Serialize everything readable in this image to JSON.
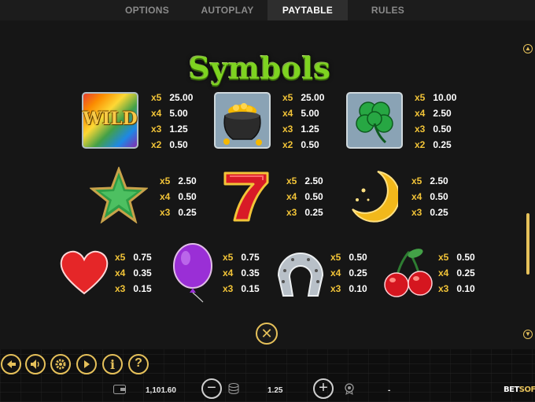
{
  "tabs": [
    {
      "label": "OPTIONS",
      "active": false
    },
    {
      "label": "AUTOPLAY",
      "active": false
    },
    {
      "label": "PAYTABLE",
      "active": true
    },
    {
      "label": "RULES",
      "active": false
    }
  ],
  "paytable": {
    "title": "Symbols",
    "wild_label": "WILD",
    "symbols": [
      {
        "name": "wild",
        "icon": "wild-rainbow-icon",
        "pays": [
          {
            "mult": "x5",
            "value": "25.00"
          },
          {
            "mult": "x4",
            "value": "5.00"
          },
          {
            "mult": "x3",
            "value": "1.25"
          },
          {
            "mult": "x2",
            "value": "0.50"
          }
        ]
      },
      {
        "name": "pot-of-gold",
        "icon": "pot-of-gold-icon",
        "pays": [
          {
            "mult": "x5",
            "value": "25.00"
          },
          {
            "mult": "x4",
            "value": "5.00"
          },
          {
            "mult": "x3",
            "value": "1.25"
          },
          {
            "mult": "x2",
            "value": "0.50"
          }
        ]
      },
      {
        "name": "clover",
        "icon": "four-leaf-clover-icon",
        "pays": [
          {
            "mult": "x5",
            "value": "10.00"
          },
          {
            "mult": "x4",
            "value": "2.50"
          },
          {
            "mult": "x3",
            "value": "0.50"
          },
          {
            "mult": "x2",
            "value": "0.25"
          }
        ]
      },
      {
        "name": "star",
        "icon": "green-star-icon",
        "pays": [
          {
            "mult": "x5",
            "value": "2.50"
          },
          {
            "mult": "x4",
            "value": "0.50"
          },
          {
            "mult": "x3",
            "value": "0.25"
          }
        ]
      },
      {
        "name": "seven",
        "icon": "lucky-seven-icon",
        "pays": [
          {
            "mult": "x5",
            "value": "2.50"
          },
          {
            "mult": "x4",
            "value": "0.50"
          },
          {
            "mult": "x3",
            "value": "0.25"
          }
        ]
      },
      {
        "name": "moon",
        "icon": "crescent-moon-icon",
        "pays": [
          {
            "mult": "x5",
            "value": "2.50"
          },
          {
            "mult": "x4",
            "value": "0.50"
          },
          {
            "mult": "x3",
            "value": "0.25"
          }
        ]
      },
      {
        "name": "heart",
        "icon": "red-heart-icon",
        "pays": [
          {
            "mult": "x5",
            "value": "0.75"
          },
          {
            "mult": "x4",
            "value": "0.35"
          },
          {
            "mult": "x3",
            "value": "0.15"
          }
        ]
      },
      {
        "name": "balloon",
        "icon": "purple-balloon-icon",
        "pays": [
          {
            "mult": "x5",
            "value": "0.75"
          },
          {
            "mult": "x4",
            "value": "0.35"
          },
          {
            "mult": "x3",
            "value": "0.15"
          }
        ]
      },
      {
        "name": "horseshoe",
        "icon": "horseshoe-icon",
        "pays": [
          {
            "mult": "x5",
            "value": "0.50"
          },
          {
            "mult": "x4",
            "value": "0.25"
          },
          {
            "mult": "x3",
            "value": "0.10"
          }
        ]
      },
      {
        "name": "cherries",
        "icon": "cherries-icon",
        "pays": [
          {
            "mult": "x5",
            "value": "0.50"
          },
          {
            "mult": "x4",
            "value": "0.25"
          },
          {
            "mult": "x3",
            "value": "0.10"
          }
        ]
      }
    ]
  },
  "controls": {
    "icons": [
      "back-arrow-icon",
      "sound-icon",
      "settings-gear-icon",
      "autoplay-icon",
      "info-icon",
      "help-icon"
    ],
    "info_label": "i",
    "help_label": "?",
    "close_label": "✕"
  },
  "footer": {
    "balance": "1,101.60",
    "bet": "1.25",
    "win": "-",
    "minus_label": "−",
    "plus_label": "+",
    "brand_a": "BET",
    "brand_b": "SOFT"
  },
  "colors": {
    "accent": "#e6c15a",
    "title_green": "#7ed321",
    "mult_yellow": "#f2c438"
  }
}
